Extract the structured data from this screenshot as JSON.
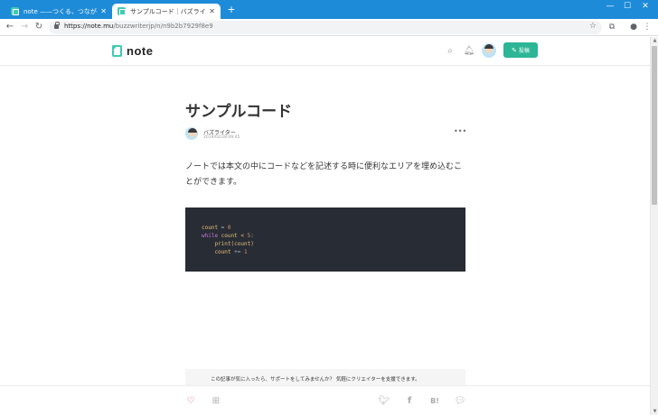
{
  "browser": {
    "tabs": [
      {
        "title": "note ——つくる、つながる、とどける。",
        "active": false
      },
      {
        "title": "サンプルコード｜バズライター｜note",
        "active": true
      }
    ],
    "new_tab": "+",
    "window_controls": {
      "minimize": "—",
      "maximize": "☐",
      "close": "✕"
    },
    "url_host": "https://note.mu",
    "url_path": "/buzzwriterjp/n/n9b2b7929f8e9"
  },
  "site": {
    "logo": "note",
    "post_button": "投稿",
    "accent_color": "#2cb696"
  },
  "article": {
    "title": "サンプルコード",
    "author": "バズライター",
    "date": "2019/02/28 09:45",
    "more": "•••",
    "paragraph": "ノートでは本文の中にコードなどを記述する時に便利なエリアを埋め込むことができます。",
    "code_lines": [
      [
        "count",
        " = ",
        "0"
      ],
      [
        "while",
        " count < ",
        "5",
        ":"
      ],
      [
        "    print",
        "(count)"
      ],
      [
        "    count",
        " += ",
        "1"
      ]
    ]
  },
  "support": {
    "message": "この記事が気に入ったら、サポートをしてみませんか？ 気軽にクリエイターを支援できます。"
  },
  "icons": {
    "heart": "heart-icon",
    "magazine": "add-to-magazine-icon",
    "twitter": "twitter-icon",
    "facebook": "facebook-icon",
    "hatena": "B!",
    "line": "line-icon"
  }
}
